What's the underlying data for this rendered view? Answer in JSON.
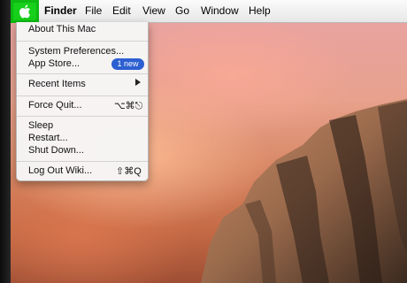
{
  "menubar": {
    "apple_icon": "apple-logo-icon",
    "items": [
      "Finder",
      "File",
      "Edit",
      "View",
      "Go",
      "Window",
      "Help"
    ]
  },
  "apple_menu": {
    "about": "About This Mac",
    "system_prefs": "System Preferences...",
    "app_store": "App Store...",
    "app_store_badge": "1 new",
    "recent_items": "Recent Items",
    "recent_items_arrow_icon": "submenu-arrow-icon",
    "force_quit": "Force Quit...",
    "force_quit_shortcut": "⌥⌘⎋",
    "sleep": "Sleep",
    "restart": "Restart...",
    "shut_down": "Shut Down...",
    "log_out": "Log Out Wiki...",
    "log_out_shortcut": "⇧⌘Q"
  },
  "colors": {
    "highlight": "#16d01a",
    "badge": "#2c5fd1"
  }
}
